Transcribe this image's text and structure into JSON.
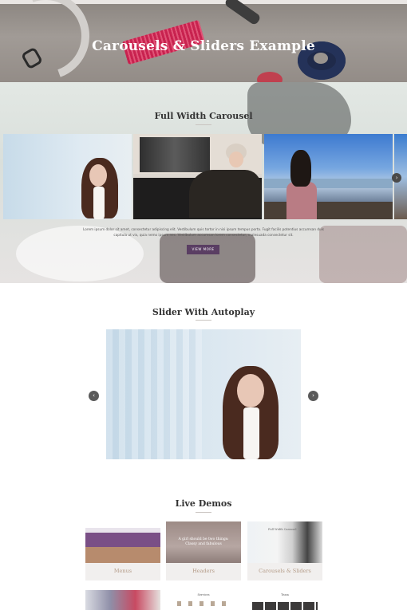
{
  "hero": {
    "title": "Carousels & Sliders Example"
  },
  "full_width": {
    "title": "Full Width Carousel",
    "slides": [
      "girl-window",
      "blonde-woman-sofa",
      "woman-seaside"
    ],
    "body_text": "Lorem ipsum dolor sit amet, consectetur adipiscing elit. Vestibulum quis tortor in nisi ipsum tempus porta. Fugit facilis potentius accumsan duis capitula ut vix, quia nemo ipsum nec. Vestibulum accumsan lorem consectetur, malesuada consectetur sit.",
    "button": "VIEW MORE"
  },
  "autoplay": {
    "title": "Slider With Autoplay",
    "prev": "‹",
    "next": "›"
  },
  "demos": {
    "title": "Live Demos",
    "cards": [
      {
        "label": "Menus"
      },
      {
        "label": "Headers",
        "thumb_text": "A girl should be two things: Classy and fabulous"
      },
      {
        "label": "Carousels & Sliders",
        "thumb_text": "Full Width Carousel"
      }
    ],
    "row2": [
      {
        "label": ""
      },
      {
        "label": "Services"
      },
      {
        "label": "Team"
      }
    ]
  },
  "colors": {
    "accent": "#5a3e63",
    "demo_label": "#b39a86"
  }
}
